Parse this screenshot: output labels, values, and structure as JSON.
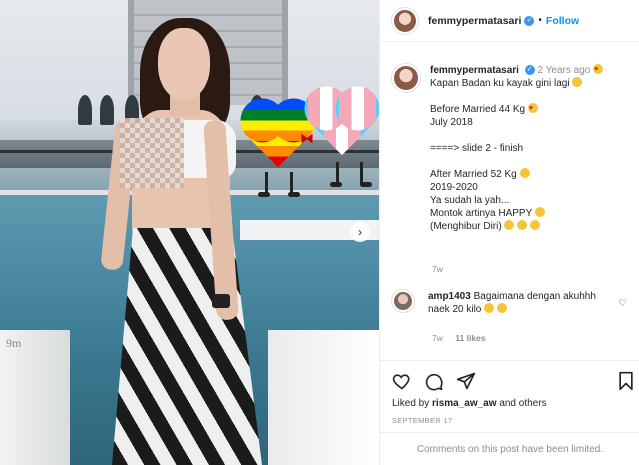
{
  "post": {
    "username": "femmypermatasari",
    "follow_label": "Follow",
    "separator": "•",
    "verified_icon": "verified-badge-icon",
    "photo_watermark": "9m"
  },
  "caption": {
    "username": "femmypermatasari",
    "age": "2 Years ago",
    "lines": [
      "Kapan Badan ku kayak gini lagi",
      "",
      "Before Married 44 Kg",
      "July 2018",
      "",
      "====> slide 2 - finish",
      "",
      "After Married 52 Kg",
      "2019-2020",
      "Ya sudah la yah...",
      "Montok artinya HAPPY",
      "(Menghibur Diri)"
    ],
    "time": "7w"
  },
  "comment": {
    "username": "amp1403",
    "text": "Bagaimana dengan akuhhh naek 20 kilo",
    "time": "7w",
    "likes": "11 likes"
  },
  "engagement": {
    "liked_by_prefix": "Liked by",
    "liked_by_user": "risma_aw_aw",
    "liked_by_suffix": "and others",
    "date": "SEPTEMBER 17",
    "comments_limited": "Comments on this post have been limited."
  },
  "colors": {
    "accent": "#0095f6",
    "verified": "#3897f0",
    "muted": "#8e8e8e"
  }
}
